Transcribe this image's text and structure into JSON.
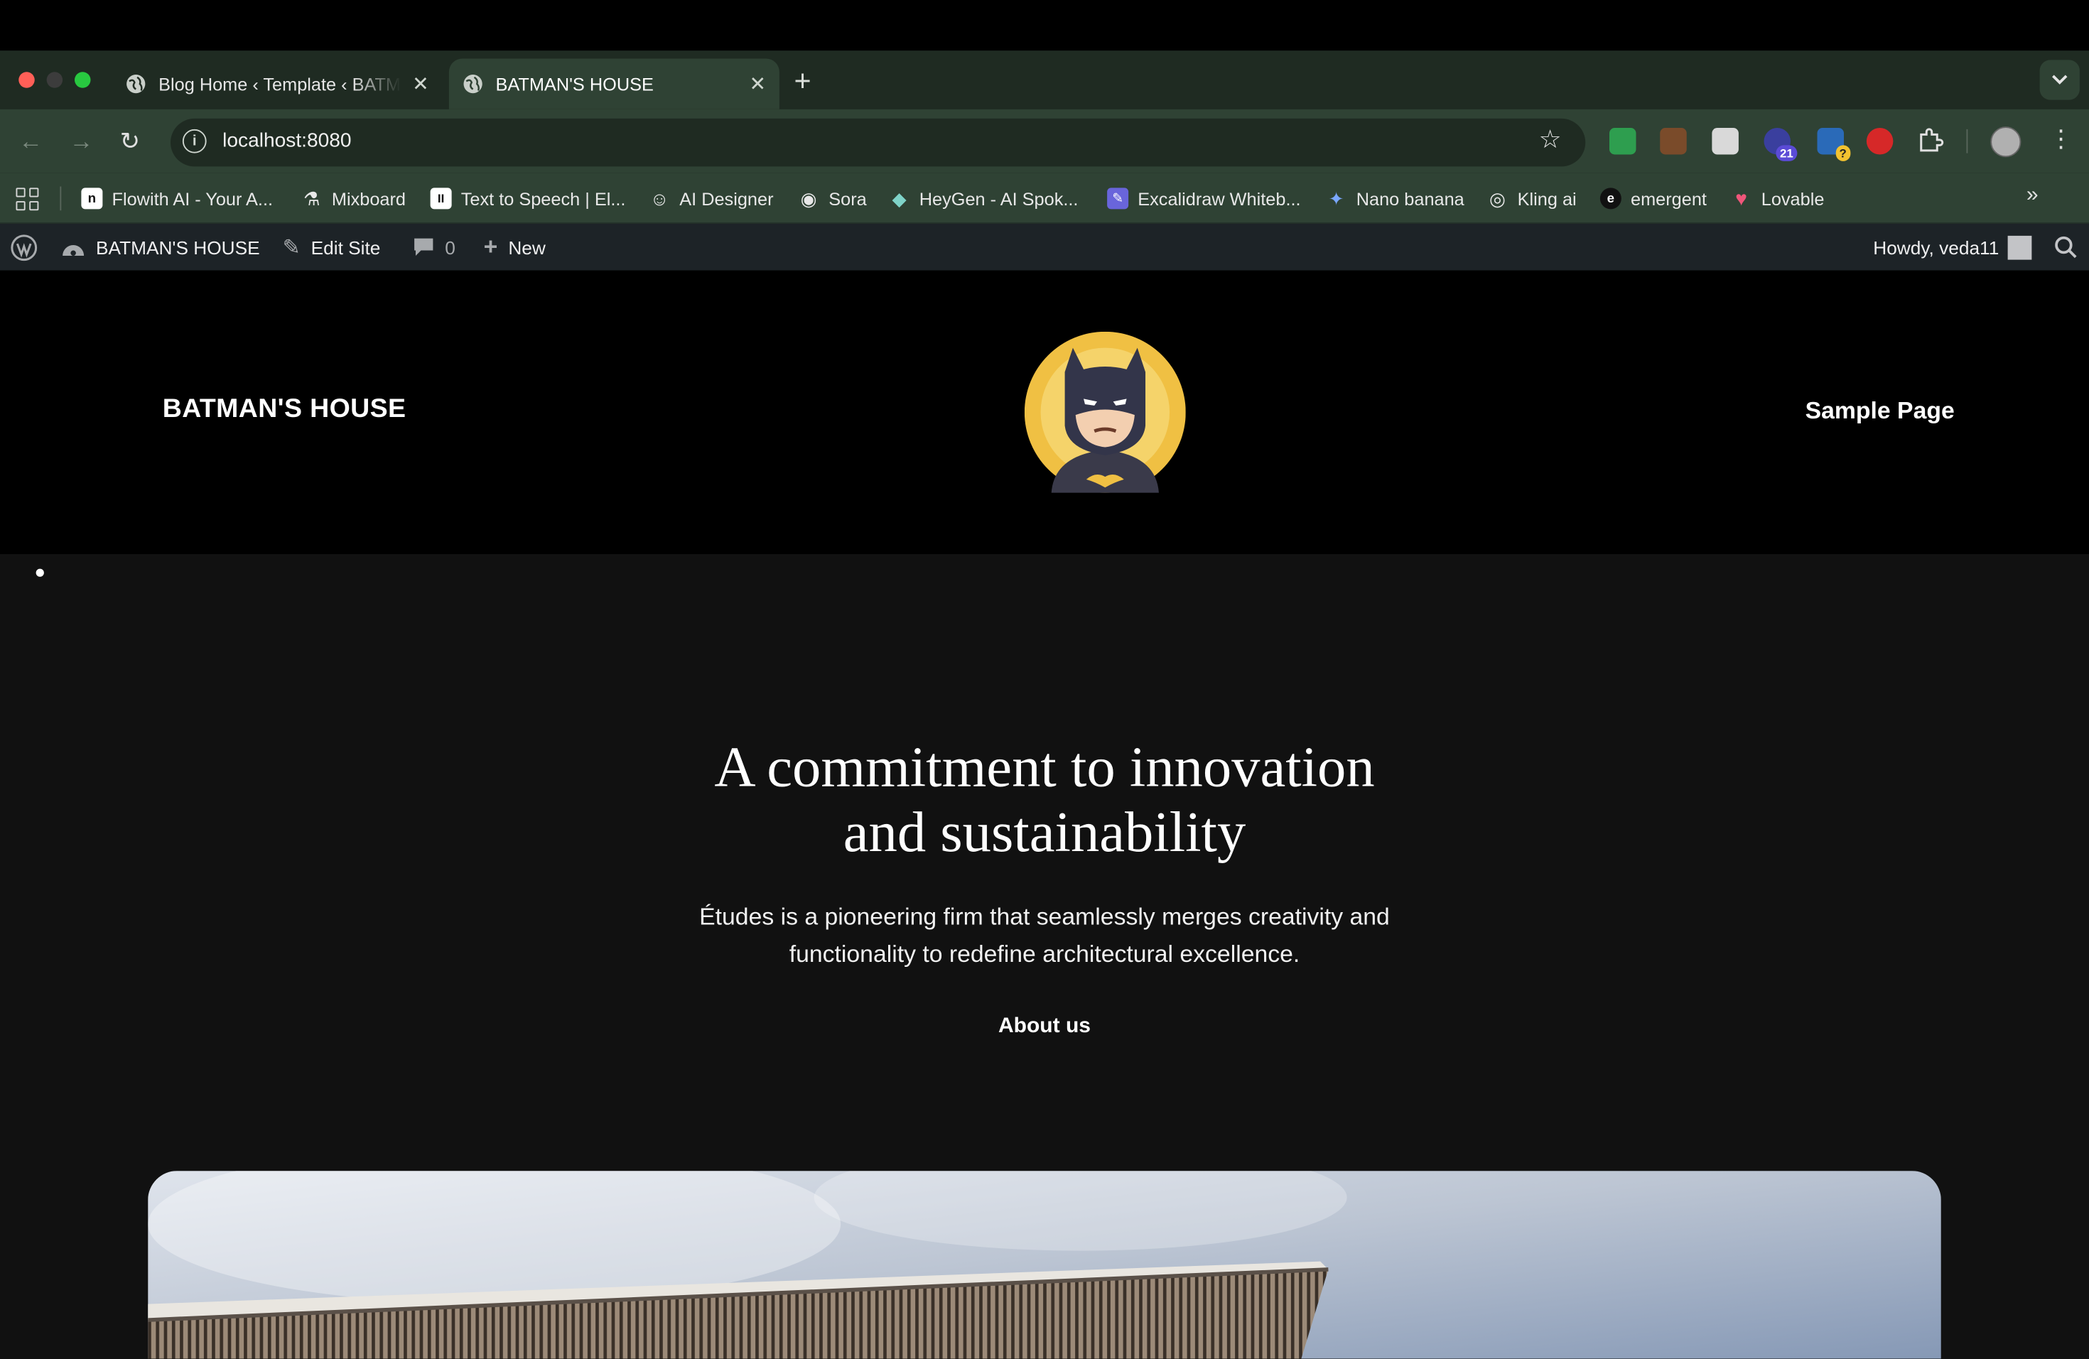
{
  "browser": {
    "tabs": [
      {
        "title": "Blog Home ‹ Template ‹ BATMAN'S HOUSE",
        "active": false
      },
      {
        "title": "BATMAN'S HOUSE",
        "active": true
      }
    ],
    "new_tab": "+",
    "tab_menu": "⌄",
    "address": "localhost:8080",
    "extensions": [
      {
        "name": "sheets-icon",
        "color": "#2e9e4f"
      },
      {
        "name": "photo-ext-icon",
        "color": "#7a4b2a"
      },
      {
        "name": "doc-ext-icon",
        "color": "#d9d9d9"
      },
      {
        "name": "ext-21-icon",
        "color": "#3a3f9e",
        "badge": "21",
        "badge_color": "#5b4bd6"
      },
      {
        "name": "ext-question-icon",
        "color": "#2a6ab8",
        "badge": "?",
        "badge_color": "#f2c230"
      },
      {
        "name": "hand-stop-icon",
        "color": "#d62828"
      }
    ],
    "bookmarks": [
      {
        "label": "Flowith AI - Your A...",
        "icon": "flowith-icon",
        "color": "#ffffff",
        "glyph": "n"
      },
      {
        "label": "Mixboard",
        "icon": "flask-icon",
        "color": "#2f4234",
        "glyph": "⚗"
      },
      {
        "label": "Text to Speech | El...",
        "icon": "elevenlabs-icon",
        "color": "#ffffff",
        "glyph": "II"
      },
      {
        "label": "AI Designer",
        "icon": "ai-designer-icon",
        "color": "#2f4234",
        "glyph": "☺"
      },
      {
        "label": "Sora",
        "icon": "sora-icon",
        "color": "#2f4234",
        "glyph": "◉"
      },
      {
        "label": "HeyGen - AI Spok...",
        "icon": "heygen-icon",
        "color": "#2f4234",
        "glyph": "◆"
      },
      {
        "label": "Excalidraw Whiteb...",
        "icon": "excalidraw-icon",
        "color": "#6965db",
        "glyph": "✎"
      },
      {
        "label": "Nano banana",
        "icon": "gemini-icon",
        "color": "#2f4234",
        "glyph": "✦"
      },
      {
        "label": "Kling ai",
        "icon": "kling-icon",
        "color": "#2f4234",
        "glyph": "◎"
      },
      {
        "label": "emergent",
        "icon": "emergent-icon",
        "color": "#111111",
        "glyph": "e"
      },
      {
        "label": "Lovable",
        "icon": "lovable-icon",
        "color": "#f0567a",
        "glyph": "♥"
      }
    ],
    "more_bookmarks": "»"
  },
  "admin_bar": {
    "site_name": "BATMAN'S HOUSE",
    "edit_site": "Edit Site",
    "comments_count": "0",
    "new": "New",
    "howdy": "Howdy, veda11"
  },
  "site": {
    "title": "BATMAN'S HOUSE",
    "nav_item": "Sample Page"
  },
  "hero": {
    "title_line1": "A commitment to innovation",
    "title_line2": "and sustainability",
    "text_line1": "Études is a pioneering firm that seamlessly merges creativity and",
    "text_line2": "functionality to redefine architectural excellence.",
    "link": "About us"
  },
  "colors": {
    "page_bg": "#111111",
    "header_bg": "#000000",
    "admin_bar_bg": "#1d2327",
    "browser_chrome": "#2f4234",
    "logo_gold": "#f0c043"
  }
}
